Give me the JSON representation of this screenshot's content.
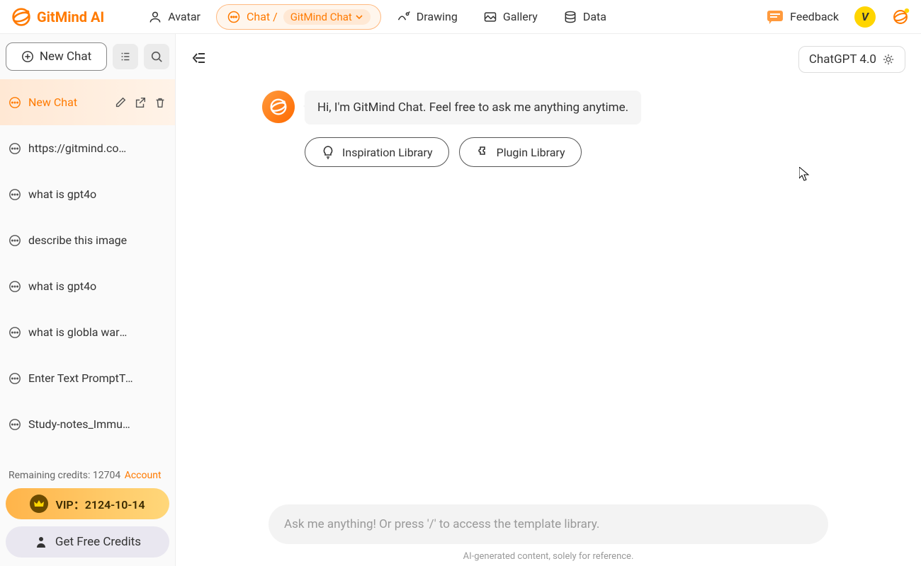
{
  "brand": "GitMind AI",
  "nav": {
    "avatar": "Avatar",
    "chat_prefix": "Chat /",
    "chat_sub": "GitMind Chat",
    "drawing": "Drawing",
    "gallery": "Gallery",
    "data": "Data",
    "feedback": "Feedback",
    "avatar_letter": "V"
  },
  "sidebar": {
    "new_chat": "New Chat",
    "items": [
      {
        "label": "New Chat"
      },
      {
        "label": "https://gitmind.com/faq..."
      },
      {
        "label": "what is gpt4o"
      },
      {
        "label": "describe this image"
      },
      {
        "label": "what is gpt4o"
      },
      {
        "label": "what is globla warming"
      },
      {
        "label": "Enter Text PromptType ..."
      },
      {
        "label": "Study-notes_Immune-s..."
      }
    ],
    "credits_label": "Remaining credits: ",
    "credits_value": "12704",
    "account": "Account",
    "vip": "VIP：2124-10-14",
    "free_credits": "Get Free Credits"
  },
  "main": {
    "model": "ChatGPT 4.0",
    "greeting": "Hi, I'm GitMind Chat. Feel free to ask me anything anytime.",
    "inspiration": "Inspiration Library",
    "plugin": "Plugin Library",
    "placeholder": "Ask me anything! Or press '/' to access the template library.",
    "disclaimer": "AI-generated content, solely for reference."
  }
}
